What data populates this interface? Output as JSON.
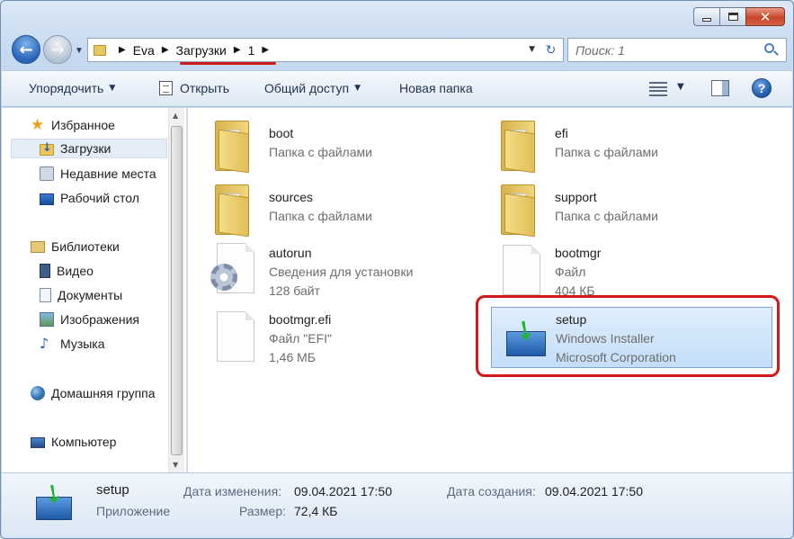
{
  "window": {
    "minimize_icon": "minimize-icon",
    "maximize_icon": "maximize-icon",
    "close_glyph": "✕"
  },
  "nav": {
    "back_glyph": "←",
    "forward_glyph": "→",
    "breadcrumb": [
      "Eva",
      "Загрузки",
      "1"
    ],
    "search_placeholder": "Поиск: 1",
    "refresh_glyph": "↻"
  },
  "toolbar": {
    "organize": "Упорядочить",
    "open": "Открыть",
    "share": "Общий доступ",
    "new_folder": "Новая папка",
    "help": "?"
  },
  "sidebar": {
    "favorites": "Избранное",
    "downloads": "Загрузки",
    "recent": "Недавние места",
    "desktop": "Рабочий стол",
    "libraries": "Библиотеки",
    "video": "Видео",
    "documents": "Документы",
    "images": "Изображения",
    "music": "Музыка",
    "homegroup": "Домашняя группа",
    "computer": "Компьютер",
    "star_glyph": "★",
    "music_glyph": "♪"
  },
  "files": [
    {
      "name": "boot",
      "line2": "Папка с файлами",
      "line3": "",
      "icon": "folder-icon"
    },
    {
      "name": "efi",
      "line2": "Папка с файлами",
      "line3": "",
      "icon": "folder-icon"
    },
    {
      "name": "sources",
      "line2": "Папка с файлами",
      "line3": "",
      "icon": "folder-icon"
    },
    {
      "name": "support",
      "line2": "Папка с файлами",
      "line3": "",
      "icon": "folder-icon"
    },
    {
      "name": "autorun",
      "line2": "Сведения для установки",
      "line3": "128 байт",
      "icon": "settings-file-icon"
    },
    {
      "name": "bootmgr",
      "line2": "Файл",
      "line3": "404 КБ",
      "icon": "file-icon"
    },
    {
      "name": "bootmgr.efi",
      "line2": "Файл \"EFI\"",
      "line3": "1,46 МБ",
      "icon": "file-icon"
    },
    {
      "name": "setup",
      "line2": "Windows Installer",
      "line3": "Microsoft Corporation",
      "icon": "installer-icon"
    }
  ],
  "details": {
    "name": "setup",
    "type": "Приложение",
    "modified_label": "Дата изменения:",
    "modified_value": "09.04.2021 17:50",
    "created_label": "Дата создания:",
    "created_value": "09.04.2021 17:50",
    "size_label": "Размер:",
    "size_value": "72,4 КБ"
  },
  "colors": {
    "highlight": "#d01818",
    "selection": "#c4def8"
  }
}
